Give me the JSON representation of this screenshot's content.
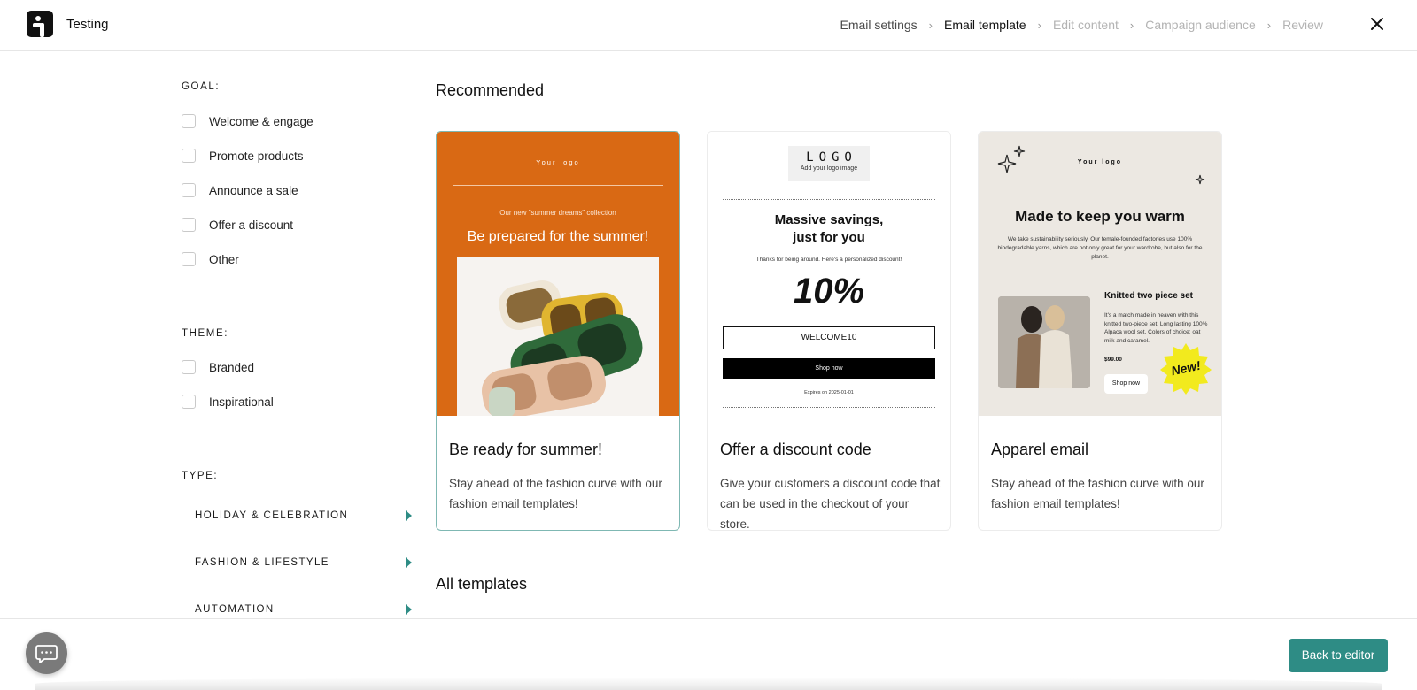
{
  "header": {
    "app_title": "Testing",
    "steps": [
      {
        "label": "Email settings",
        "state": "done"
      },
      {
        "label": "Email template",
        "state": "active"
      },
      {
        "label": "Edit content",
        "state": "disabled"
      },
      {
        "label": "Campaign audience",
        "state": "disabled"
      },
      {
        "label": "Review",
        "state": "disabled"
      }
    ]
  },
  "sidebar": {
    "goal": {
      "title": "GOAL:",
      "options": [
        "Welcome & engage",
        "Promote products",
        "Announce a sale",
        "Offer a discount",
        "Other"
      ]
    },
    "theme": {
      "title": "THEME:",
      "options": [
        "Branded",
        "Inspirational"
      ]
    },
    "type": {
      "title": "TYPE:",
      "items": [
        "HOLIDAY & CELEBRATION",
        "FASHION & LIFESTYLE",
        "AUTOMATION"
      ]
    }
  },
  "main": {
    "recommended_title": "Recommended",
    "all_templates_title": "All templates",
    "cards": [
      {
        "title": "Be ready for summer!",
        "description": "Stay ahead of the fashion curve with our fashion email templates!",
        "selected": true,
        "preview": {
          "logo": "Your logo",
          "kicker": "Our new \"summer dreams\" collection",
          "headline": "Be prepared for the summer!"
        }
      },
      {
        "title": "Offer a discount code",
        "description": "Give your customers a discount code that can be used in the checkout of your store.",
        "selected": false,
        "preview": {
          "logo": "LOGO",
          "logo_sub": "Add your logo image",
          "headline_line1": "Massive savings,",
          "headline_line2": "just for you",
          "thanks": "Thanks for being around. Here's a personalized discount!",
          "discount": "10%",
          "code": "WELCOME10",
          "button": "Shop now",
          "expires": "Expires on 2025-01-01"
        }
      },
      {
        "title": "Apparel email",
        "description": "Stay ahead of the fashion curve with our fashion email templates!",
        "selected": false,
        "preview": {
          "logo": "Your logo",
          "headline": "Made to keep you warm",
          "body": "We take sustainability seriously. Our female-founded factories use 100% biodegradable yarns, which are not only great for your wardrobe, but also for the planet.",
          "product_title": "Knitted two piece set",
          "product_desc": "It's a match made in heaven with this knitted two-piece set. Long lasting 100% Alpaca wool set. Colors of choice: oat milk and caramel.",
          "price": "$99.00",
          "button": "Shop now",
          "badge": "New!"
        }
      }
    ]
  },
  "footer": {
    "back_button": "Back to editor"
  },
  "colors": {
    "accent": "#2e8c85",
    "summer_orange": "#d96914",
    "apparel_beige": "#ece8e2"
  }
}
